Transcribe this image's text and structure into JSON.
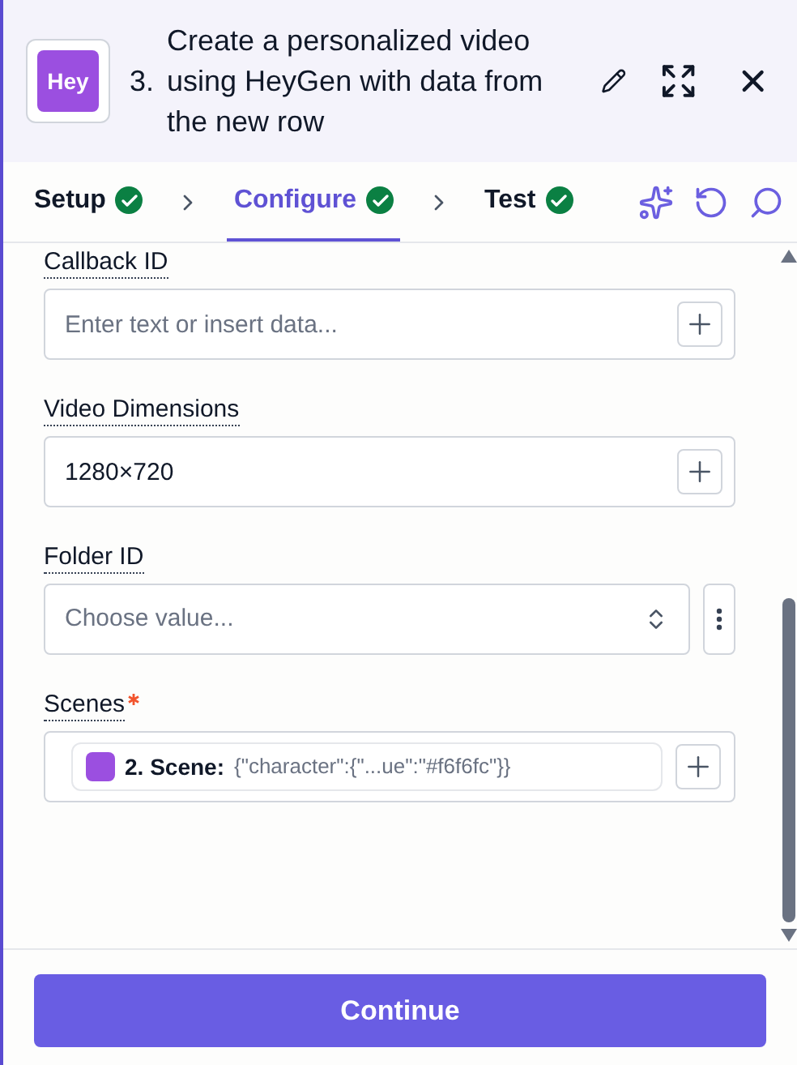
{
  "header": {
    "logo": "Hey",
    "step": "3.",
    "title": "Create a personalized video using HeyGen with data from the new row"
  },
  "tabs": [
    {
      "label": "Setup",
      "selected": false,
      "done": true
    },
    {
      "label": "Configure",
      "selected": true,
      "done": true
    },
    {
      "label": "Test",
      "selected": false,
      "done": true
    }
  ],
  "fields": [
    {
      "kind": "text",
      "label": "Callback ID",
      "required": false,
      "placeholder": "Enter text or insert data..."
    },
    {
      "kind": "text",
      "label": "Video Dimensions",
      "required": false,
      "value": "1280×720"
    },
    {
      "kind": "select",
      "label": "Folder ID",
      "required": false,
      "placeholder": "Choose value..."
    },
    {
      "kind": "pill",
      "label": "Scenes",
      "required": true,
      "pill_label": "2. Scene:",
      "pill_value": "{\"character\":{\"...ue\":\"#f6f6fc\"}}"
    }
  ],
  "continue_button": "Continue"
}
